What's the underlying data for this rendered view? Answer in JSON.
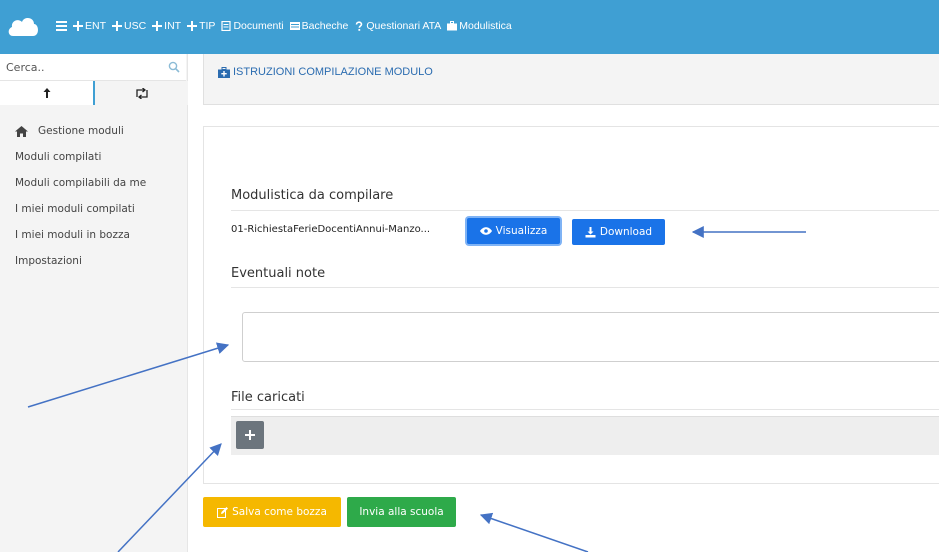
{
  "topbar": {
    "nav": [
      {
        "label": "ENT",
        "icon": "plus-icon"
      },
      {
        "label": "USC",
        "icon": "plus-icon"
      },
      {
        "label": "INT",
        "icon": "plus-icon"
      },
      {
        "label": "TIP",
        "icon": "plus-icon"
      },
      {
        "label": "Documenti",
        "icon": "document-icon"
      },
      {
        "label": "Bacheche",
        "icon": "board-icon"
      },
      {
        "label": "Questionari ATA",
        "icon": "question-icon"
      },
      {
        "label": "Modulistica",
        "icon": "briefcase-icon"
      }
    ],
    "bg_color": "#3f9fd3"
  },
  "sidebar": {
    "search_placeholder": "Cerca..",
    "items": [
      {
        "label": "Gestione moduli"
      },
      {
        "label": "Moduli compilati"
      },
      {
        "label": "Moduli compilabili da me"
      },
      {
        "label": "I miei moduli compilati"
      },
      {
        "label": "I miei moduli in bozza"
      },
      {
        "label": "Impostazioni"
      }
    ]
  },
  "main": {
    "instructions_title": "ISTRUZIONI COMPILAZIONE MODULO",
    "modulistica_label": "Modulistica da compilare",
    "filename": "01-RichiestaFerieDocentiAnnui-Manzo...",
    "view_button": "Visualizza",
    "download_button": "Download",
    "notes_label": "Eventuali note",
    "notes_value": "",
    "files_label": "File caricati",
    "save_draft_button": "Salva come bozza",
    "send_button": "Invia alla scuola"
  },
  "colors": {
    "primary": "#1a73e8",
    "warning": "#f5b800",
    "success": "#2eaa4a",
    "annotation_arrow": "#4472c4"
  }
}
